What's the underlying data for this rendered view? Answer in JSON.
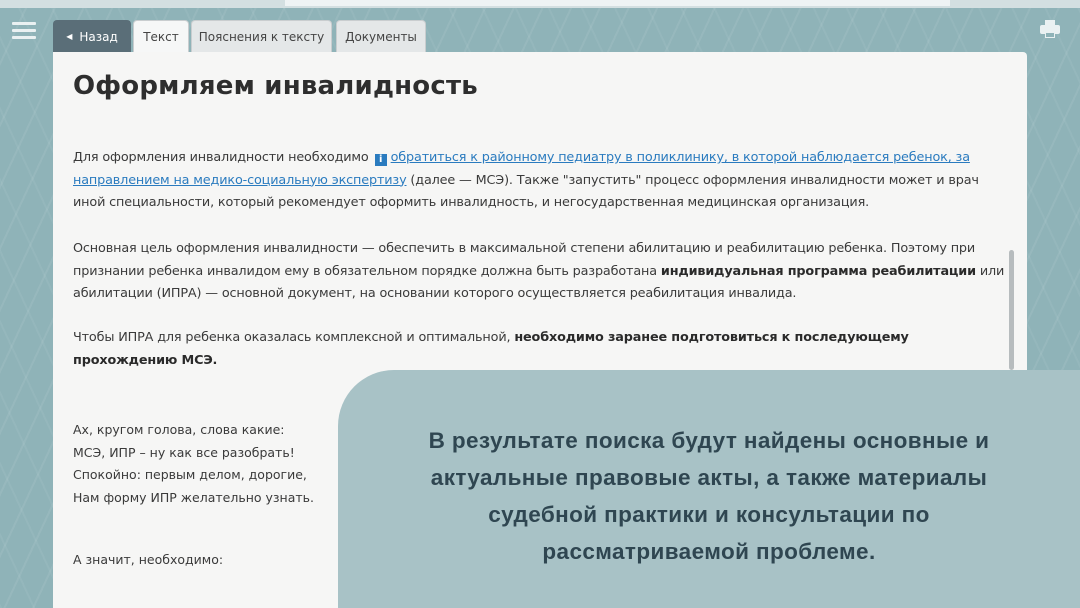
{
  "tabs": {
    "back": "Назад",
    "text": "Текст",
    "notes": "Пояснения к тексту",
    "documents": "Документы"
  },
  "article": {
    "title": "Оформляем инвалидность",
    "p1_start": "Для оформления инвалидности необходимо",
    "p1_link": "обратиться к районному педиатру в поликлинику, в которой наблюдается ребенок, за направлением на медико-социальную экспертизу",
    "p1_end": " (далее — МСЭ). Также \"запустить\" процесс оформления инвалидности может и врач иной специальности, который рекомендует оформить инвалидность, и негосударственная медицинская организация.",
    "p2_start": "Основная цель оформления инвалидности — обеспечить в максимальной степени абилитацию и реабилитацию ребенка.  Поэтому при признании ребенка инвалидом ему в обязательном порядке должна быть разработана ",
    "p2_bold": "индивидуальная программа реабилитации",
    "p2_end": " или абилитации (ИПРА) — основной документ, на основании которого осуществляется реабилитация инвалида.",
    "p3_start": "Чтобы ИПРА для ребенка оказалась комплексной и оптимальной, ",
    "p3_bold": "необходимо заранее подготовиться к последующему прохождению МСЭ.",
    "poem": [
      "Ах,  кругом голова, слова какие:",
      "МСЭ, ИПР – ну как все разобрать!",
      "Спокойно: первым делом, дорогие,",
      "Нам форму ИПР желательно узнать."
    ],
    "tail": "А значит, необходимо:"
  },
  "overlay": {
    "lines": [
      "В результате поиска будут найдены основные и",
      "актуальные правовые акты, а также материалы",
      "судебной практики и консультации по",
      "рассматриваемой проблеме."
    ]
  },
  "icons": {
    "menu": "hamburger-menu-icon",
    "print": "printer-icon",
    "info": "info-icon",
    "back_arrow": "triangle-left-icon"
  },
  "colors": {
    "background": "#8fb3b8",
    "link": "#2a7bbf",
    "back_tab": "#5a6e78",
    "overlay": "#a8c2c6",
    "overlay_text": "#2f4651"
  }
}
